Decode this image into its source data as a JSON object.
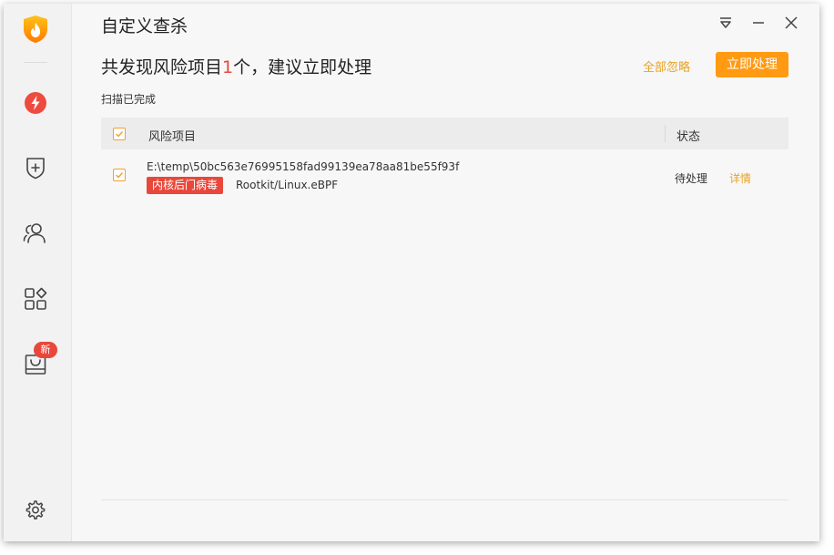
{
  "window": {
    "title": "自定义查杀"
  },
  "sidebar": {
    "logo_icon": "flame-shield-logo",
    "items": [
      {
        "icon": "lightning-icon",
        "active": true
      },
      {
        "icon": "shield-plus-icon"
      },
      {
        "icon": "users-icon"
      },
      {
        "icon": "apps-grid-icon"
      },
      {
        "icon": "box-icon",
        "badge": "新"
      }
    ],
    "settings_icon": "gear-icon"
  },
  "header": {
    "headline_prefix": "共发现风险项目",
    "headline_count": "1",
    "headline_suffix": "个，建议立即处理",
    "ignore_all": "全部忽略",
    "handle_now": "立即处理"
  },
  "scan_status": "扫描已完成",
  "table": {
    "columns": {
      "name": "风险项目",
      "status": "状态"
    },
    "rows": [
      {
        "path": "E:\\temp\\50bc563e76995158fad99139ea78aa81be55f93f",
        "tag": "内核后门病毒",
        "virus_name": "Rootkit/Linux.eBPF",
        "status": "待处理",
        "action": "详情"
      }
    ]
  },
  "colors": {
    "accent": "#ff9a12",
    "danger": "#e8483b",
    "link": "#e8a321"
  }
}
